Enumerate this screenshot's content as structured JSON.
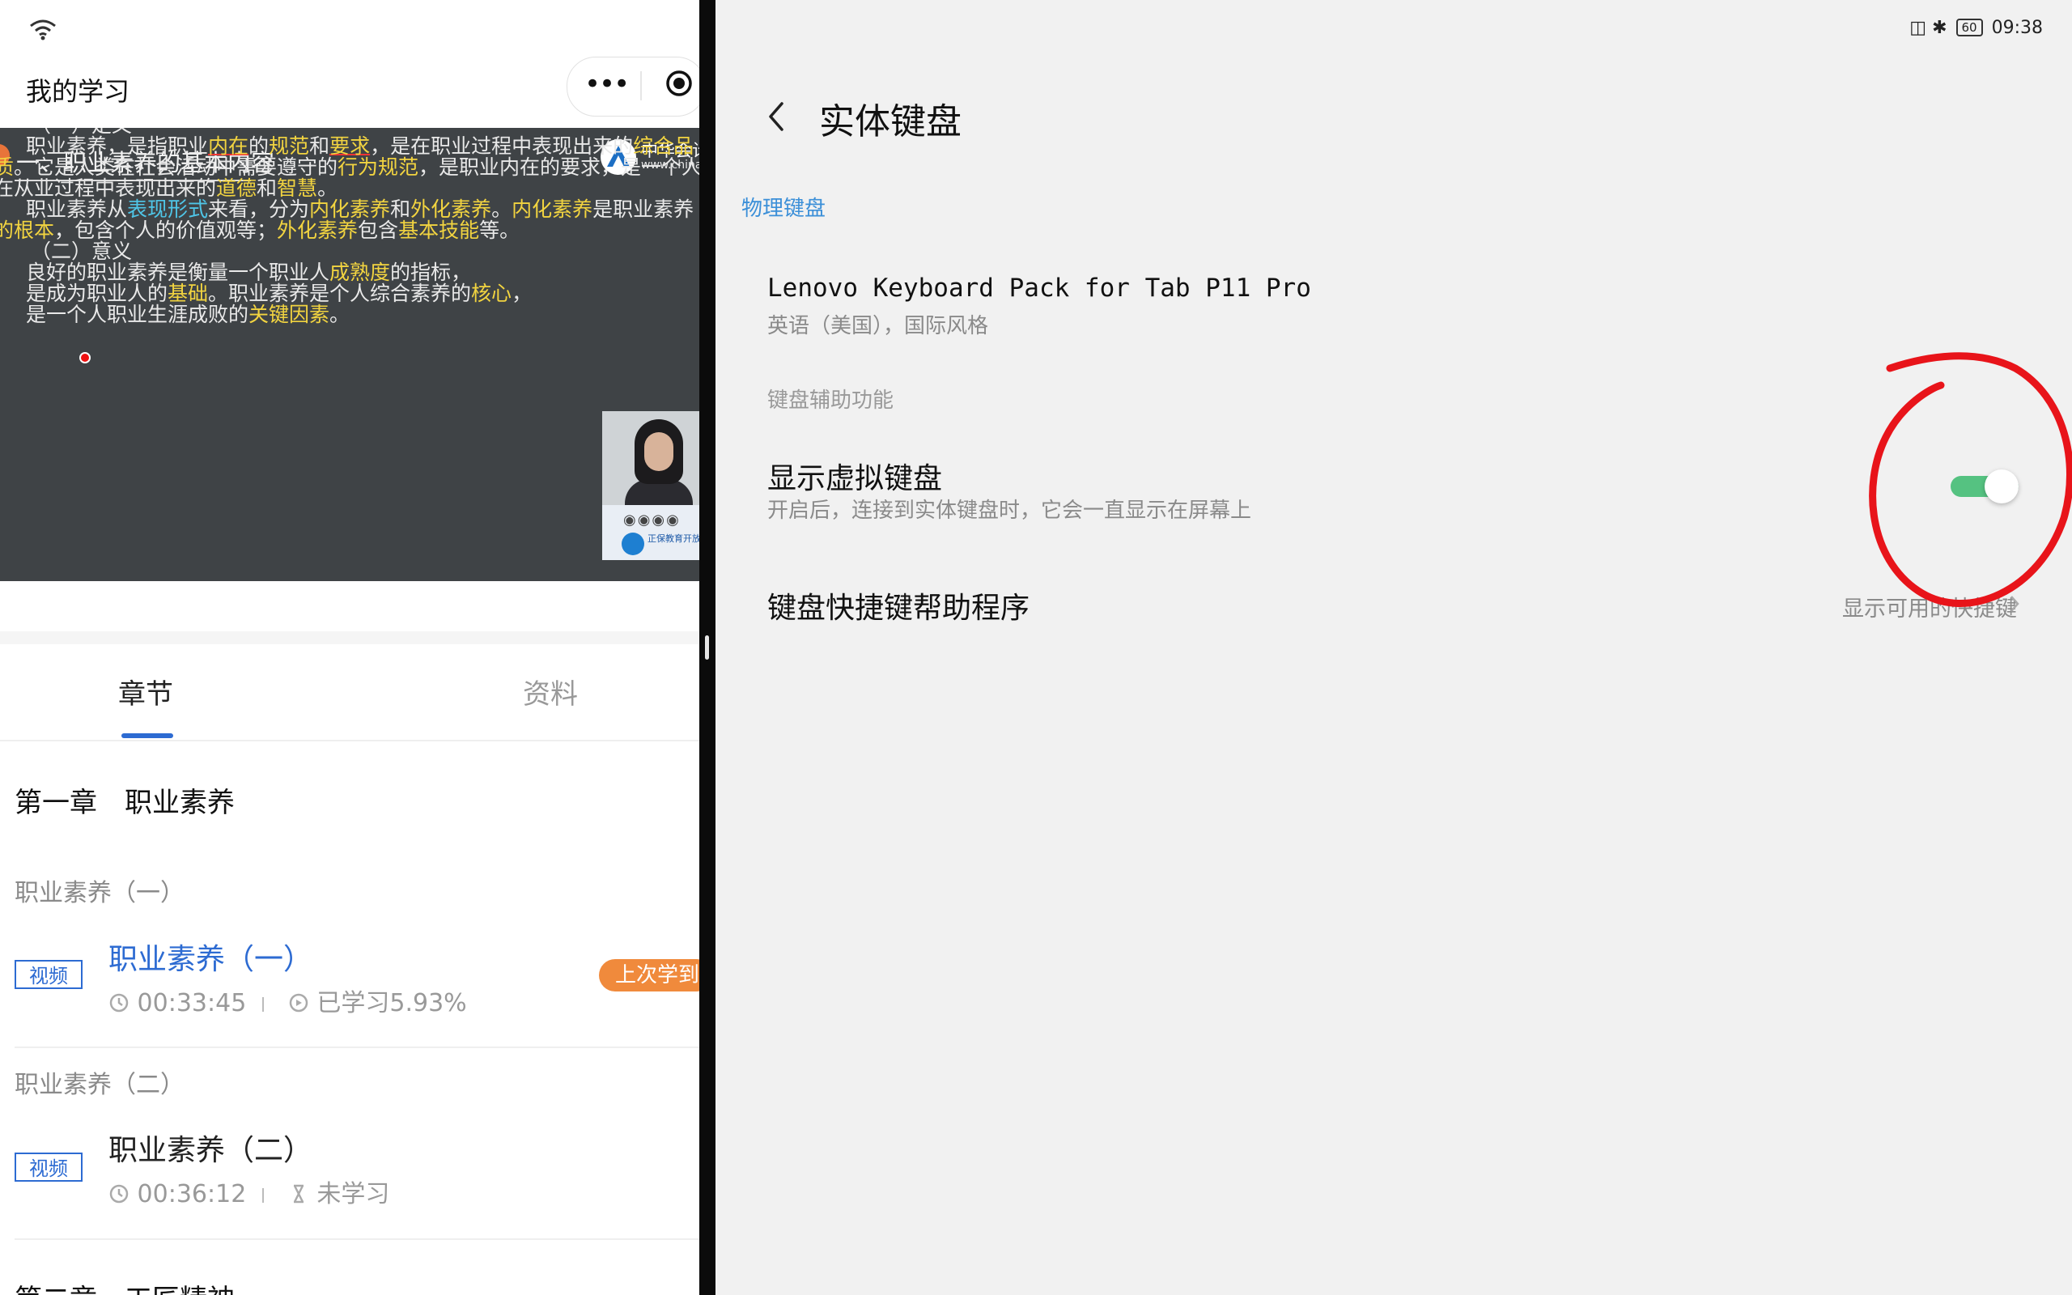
{
  "left_app": {
    "title": "我的学习",
    "capsule": {
      "more": "•••"
    },
    "video": {
      "heading": "一、职业素养的基本内容",
      "logo_name": "中华会计",
      "logo_url": "www.china",
      "camera_caption": "正保教育开放",
      "lines": [
        {
          "segments": [
            {
              "text": "（一）定义"
            }
          ]
        },
        {
          "segments": [
            {
              "text": "职业素养，是指职业"
            },
            {
              "text": "内在",
              "style": "y ur"
            },
            {
              "text": "的"
            },
            {
              "text": "规范",
              "style": "y"
            },
            {
              "text": "和"
            },
            {
              "text": "要求",
              "style": "y ur"
            },
            {
              "text": "，是在职业过程中表现出来的"
            },
            {
              "text": "综合品",
              "style": "y"
            }
          ]
        },
        {
          "segments": [
            {
              "text": "质",
              "style": "y"
            },
            {
              "text": "。它是人类在社会活动中需要遵守的"
            },
            {
              "text": "行为规范",
              "style": "y"
            },
            {
              "text": "，是职业内在的要求，是一个人"
            }
          ]
        },
        {
          "segments": [
            {
              "text": "在从业过程中表现出来的"
            },
            {
              "text": "道德",
              "style": "y"
            },
            {
              "text": "和"
            },
            {
              "text": "智慧",
              "style": "y"
            },
            {
              "text": "。"
            }
          ]
        },
        {
          "segments": [
            {
              "text": "职业素养从"
            },
            {
              "text": "表现形式",
              "style": "b"
            },
            {
              "text": "来看，分为"
            },
            {
              "text": "内化素养",
              "style": "y"
            },
            {
              "text": "和"
            },
            {
              "text": "外化素养",
              "style": "y"
            },
            {
              "text": "。"
            },
            {
              "text": "内化素养",
              "style": "y"
            },
            {
              "text": "是职业素养"
            }
          ]
        },
        {
          "segments": [
            {
              "text": "的根本",
              "style": "y"
            },
            {
              "text": "，包含个人的价值观等；"
            },
            {
              "text": "外化素养",
              "style": "y"
            },
            {
              "text": "包含"
            },
            {
              "text": "基本技能",
              "style": "y"
            },
            {
              "text": "等。"
            }
          ]
        },
        {
          "segments": [
            {
              "text": "（二）意义"
            }
          ]
        },
        {
          "segments": [
            {
              "text": "良好的职业素养是衡量一个职业人"
            },
            {
              "text": "成熟度",
              "style": "y"
            },
            {
              "text": "的指标，"
            }
          ]
        },
        {
          "segments": [
            {
              "text": "是成为职业人的"
            },
            {
              "text": "基础",
              "style": "y"
            },
            {
              "text": "。职业素养是个人综合素养的"
            },
            {
              "text": "核心",
              "style": "y"
            },
            {
              "text": "，"
            }
          ]
        },
        {
          "segments": [
            {
              "text": "是一个人职业生涯成败的"
            },
            {
              "text": "关键因素",
              "style": "y"
            },
            {
              "text": "。"
            }
          ]
        }
      ]
    },
    "tabs": [
      "章节",
      "资料"
    ],
    "chapter_title": "第一章　职业素养",
    "sections": [
      {
        "title": "职业素养（一）",
        "lesson": {
          "badge": "视频",
          "title": "职业素养（一）",
          "duration": "00:33:45",
          "progress": "已学习5.93%",
          "resume": "上次学到"
        }
      },
      {
        "title": "职业素养（二）",
        "lesson": {
          "badge": "视频",
          "title": "职业素养（二）",
          "duration": "00:36:12",
          "progress": "未学习"
        }
      }
    ],
    "next_chapter": "第二章　工匠精神"
  },
  "right_app": {
    "status": {
      "battery": "60",
      "time": "09:38"
    },
    "title": "实体键盘",
    "physical_group": "物理键盘",
    "keyboard": {
      "name": "Lenovo Keyboard Pack for Tab P11 Pro",
      "layout": "英语（美国），国际风格"
    },
    "assist_group": "键盘辅助功能",
    "virtual_kb": {
      "title": "显示虚拟键盘",
      "desc": "开启后，连接到实体键盘时，它会一直显示在屏幕上",
      "enabled": true
    },
    "shortcuts": {
      "title": "键盘快捷键帮助程序",
      "value": "显示可用的快捷键"
    }
  },
  "colors": {
    "accent_blue": "#2d6bd2",
    "switch_on": "#55c281",
    "annotation_red": "#e8141a",
    "resume_orange": "#f08a3c"
  }
}
